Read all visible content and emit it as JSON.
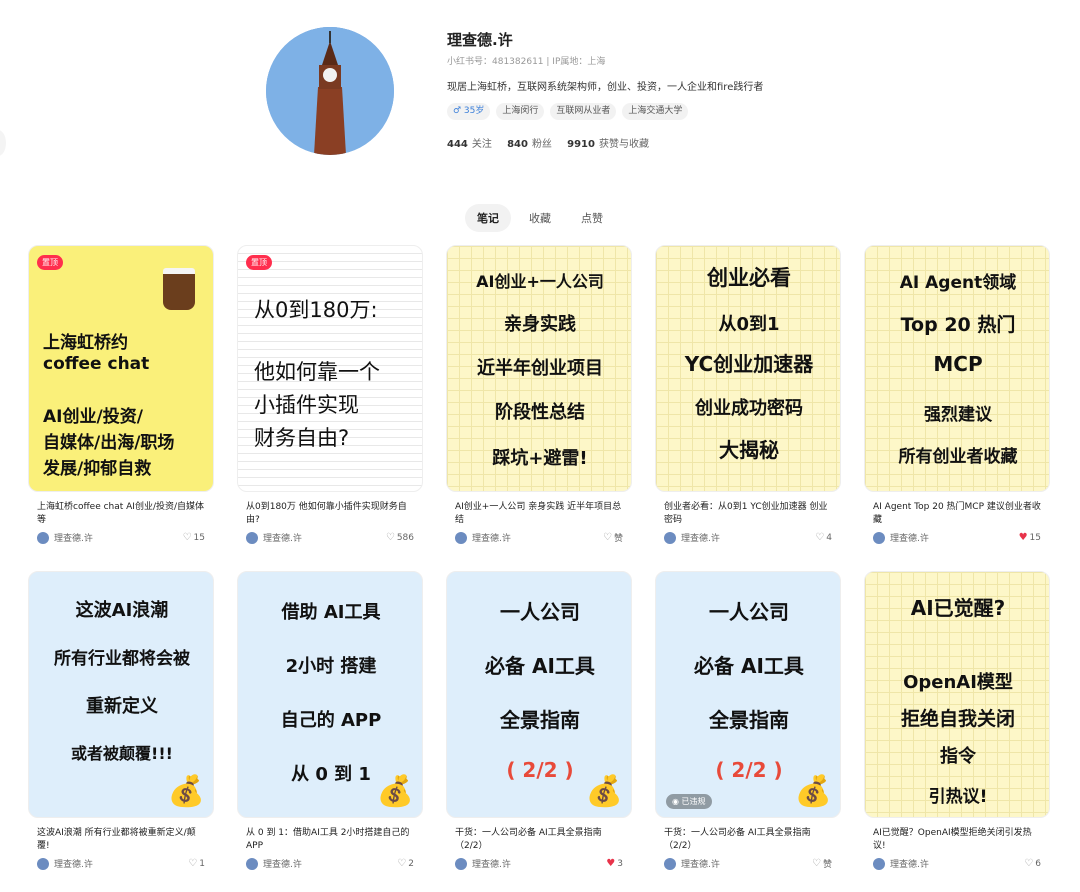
{
  "profile": {
    "name": "理查德.许",
    "meta": "小红书号：481382611 | IP属地：上海",
    "bio": "现居上海虹桥，互联网系统架构师，创业、投资，一人企业和fire践行者",
    "tags": [
      "♂ 35岁",
      "上海闵行",
      "互联网从业者",
      "上海交通大学"
    ],
    "stats": [
      {
        "n": "444",
        "l": "关注"
      },
      {
        "n": "840",
        "l": "粉丝"
      },
      {
        "n": "9910",
        "l": "获赞与收藏"
      }
    ]
  },
  "tabs": [
    "笔记",
    "收藏",
    "点赞"
  ],
  "pin_label": "置顶",
  "views_label": "◉ 已违规",
  "author": "理查德.许",
  "cards": [
    {
      "title": "上海虹桥coffee chat AI创业/投资/自媒体等",
      "likes": "15",
      "lines": [
        "上海虹桥约",
        "coffee  chat",
        "AI创业/投资/",
        "自媒体/出海/职场",
        "发展/抑郁自救"
      ]
    },
    {
      "title": "从0到180万 他如何靠小插件实现财务自由?",
      "likes": "586",
      "lines": [
        "从0到180万:",
        "他如何靠一个",
        "小插件实现",
        "财务自由?"
      ]
    },
    {
      "title": "AI创业+一人公司 亲身实践 近半年项目总结",
      "likes": "赞",
      "lines": [
        "AI创业+一人公司",
        "亲身实践",
        "近半年创业项目",
        "阶段性总结",
        "踩坑+避雷!"
      ]
    },
    {
      "title": "创业者必看：从0到1 YC创业加速器 创业密码",
      "likes": "4",
      "lines": [
        "创业必看",
        "从0到1",
        "YC创业加速器",
        "创业成功密码",
        "大揭秘"
      ]
    },
    {
      "title": "AI Agent Top 20 热门MCP 建议创业者收藏",
      "likes": "15",
      "lines": [
        "AI Agent领域",
        "Top 20 热门",
        "MCP",
        "强烈建议",
        "所有创业者收藏"
      ]
    },
    {
      "title": "这波AI浪潮 所有行业都将被重新定义/颠覆!",
      "likes": "1",
      "lines": [
        "这波AI浪潮",
        "所有行业都将会被",
        "重新定义",
        "或者被颠覆!!!"
      ]
    },
    {
      "title": "从 0 到 1：借助AI工具 2小时搭建自己的APP",
      "likes": "2",
      "lines": [
        "借助 AI工具",
        "2小时 搭建",
        "自己的 APP",
        "从 0 到 1"
      ]
    },
    {
      "title": "干货：一人公司必备 AI工具全景指南（2/2）",
      "likes": "3",
      "lines": [
        "一人公司",
        "必备 AI工具",
        "全景指南",
        "( 2/2 )"
      ]
    },
    {
      "title": "干货：一人公司必备 AI工具全景指南（2/2）",
      "likes": "赞",
      "lines": [
        "一人公司",
        "必备 AI工具",
        "全景指南",
        "( 2/2 )"
      ]
    },
    {
      "title": "AI已觉醒？OpenAI模型拒绝关闭引发热议!",
      "likes": "6",
      "lines": [
        "AI已觉醒?",
        "OpenAI模型",
        "拒绝自我关闭",
        "指令",
        "引热议!"
      ]
    }
  ],
  "colors": {
    "red": "#ff2e4d",
    "heart_liked": "#e8334a"
  }
}
